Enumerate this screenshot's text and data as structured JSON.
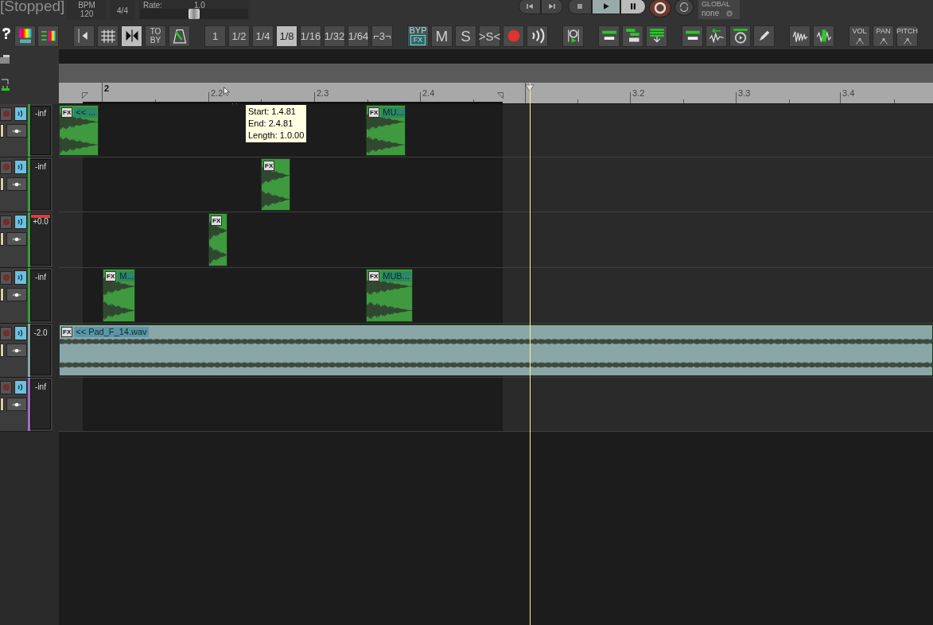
{
  "transport_panel": {
    "status": "[Stopped]",
    "bpm_label": "BPM",
    "bpm": "120",
    "time_signature": "4/4",
    "rate_label": "Rate:",
    "rate": "1.0",
    "rate_slider": {
      "level": 0.5
    }
  },
  "transport_buttons": [
    {
      "kind": "back"
    },
    {
      "kind": "forward"
    },
    {
      "kind": "stop"
    },
    {
      "kind": "play"
    },
    {
      "kind": "pause"
    },
    {
      "kind": "record"
    },
    {
      "kind": "repeat"
    }
  ],
  "automation": {
    "label": "GLOBAL",
    "mode": "none"
  },
  "toolbar": {
    "snap": {
      "selected": true
    },
    "ripple_label": "TO BY",
    "grid_divisions": [
      {
        "label": "1",
        "selected": false
      },
      {
        "label": "1/2",
        "selected": false
      },
      {
        "label": "1/4",
        "selected": false
      },
      {
        "label": "1/8",
        "selected": true
      },
      {
        "label": "1/16",
        "selected": false
      },
      {
        "label": "1/32",
        "selected": false
      },
      {
        "label": "1/64",
        "selected": false
      },
      {
        "label": "⌐3¬",
        "selected": false
      }
    ],
    "fx_bypass": {
      "top": "BYP",
      "bottom": "FX"
    },
    "mute": "M",
    "solo": "S",
    "solo_defeat": ">S<",
    "envelopes": [
      "VOL",
      "PAN",
      "PITCH"
    ]
  },
  "ruler": {
    "labels": [
      "2",
      "2.2",
      "2.3",
      "2.4",
      "3.2",
      "3.3",
      "3.4"
    ]
  },
  "tooltip": {
    "lines": [
      "Start: 1.4.81",
      "End: 2.4.81",
      "Length: 1.0.00"
    ]
  },
  "tracks": [
    {
      "color": "#3f9a3f",
      "meter": "-inf",
      "clipped": false,
      "items": [
        {
          "fx": "FX",
          "label": "<< ..."
        },
        {
          "fx": "FX",
          "label": "MU..."
        }
      ]
    },
    {
      "color": "#3f9a3f",
      "meter": "-inf",
      "clipped": false,
      "items": [
        {
          "fx": "FX"
        }
      ]
    },
    {
      "color": "#3f9a3f",
      "meter": "+0.0",
      "clipped": true,
      "items": [
        {
          "fx": "FX"
        }
      ]
    },
    {
      "color": "#3f9a3f",
      "meter": "-inf",
      "clipped": false,
      "items": [
        {
          "fx": "FX",
          "label": "M..."
        },
        {
          "fx": "FX",
          "label": "MUB..."
        }
      ]
    },
    {
      "color": "#8aa6a6",
      "meter": "-2.0",
      "clipped": false,
      "items": [
        {
          "fx": "FX",
          "label": "<< Pad_F_14.wav"
        }
      ]
    },
    {
      "color": "#a070c0",
      "meter": "-inf",
      "clipped": false
    }
  ]
}
